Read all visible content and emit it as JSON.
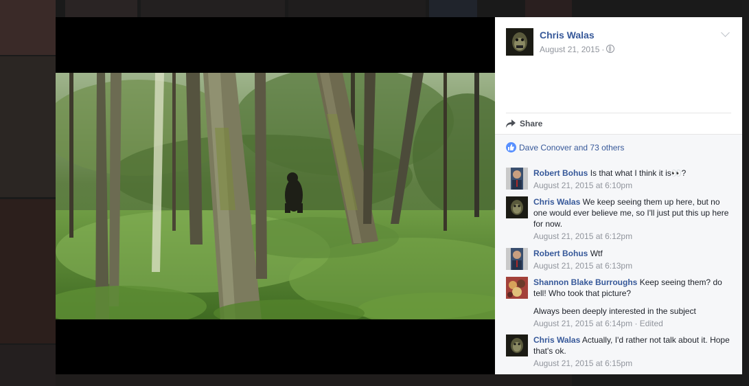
{
  "post": {
    "author": "Chris Walas",
    "date": "August 21, 2015",
    "separator": "·",
    "privacy_icon": "globe-icon",
    "share_label": "Share",
    "likes_text": "Dave Conover and 73 others"
  },
  "comments": [
    {
      "name": "Robert Bohus",
      "text": "Is that what I think it is👀?",
      "time": "August 21, 2015 at 6:10pm",
      "extra": "",
      "edited": ""
    },
    {
      "name": "Chris Walas",
      "text": "We keep seeing them up here, but no one would ever believe me, so I'll just put this up here for now.",
      "time": "August 21, 2015 at 6:12pm",
      "extra": "",
      "edited": ""
    },
    {
      "name": "Robert Bohus",
      "text": "Wtf",
      "time": "August 21, 2015 at 6:13pm",
      "extra": "",
      "edited": ""
    },
    {
      "name": "Shannon Blake Burroughs",
      "text": "Keep seeing them? do tell! Who took that picture?",
      "time": "August 21, 2015 at 6:14pm",
      "extra": "Always been deeply interested in the subject",
      "edited": "· Edited"
    },
    {
      "name": "Chris Walas",
      "text": "Actually, I'd rather not talk about it. Hope that's ok.",
      "time": "August 21, 2015 at 6:15pm",
      "extra": "",
      "edited": ""
    }
  ],
  "colors": {
    "link": "#365899",
    "meta": "#90949c",
    "like_badge": "#5890ff"
  }
}
